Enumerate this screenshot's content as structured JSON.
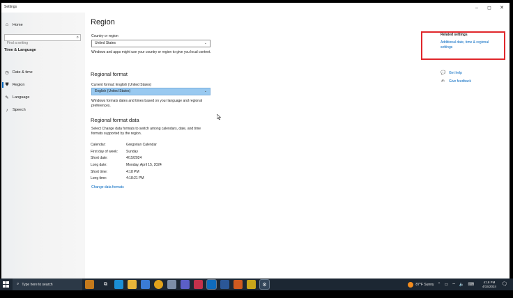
{
  "window": {
    "title": "Settings",
    "buttons": {
      "minimize": "–",
      "maximize": "◻",
      "close": "✕"
    }
  },
  "sidebar": {
    "home_label": "Home",
    "search_placeholder": "Find a setting",
    "section_title": "Time & Language",
    "items": [
      {
        "label": "Date & time",
        "icon": "calendar-clock-icon",
        "active": false
      },
      {
        "label": "Region",
        "icon": "globe-icon",
        "active": true
      },
      {
        "label": "Language",
        "icon": "language-icon",
        "active": false
      },
      {
        "label": "Speech",
        "icon": "microphone-icon",
        "active": false
      }
    ]
  },
  "main": {
    "title": "Region",
    "country_label": "Country or region",
    "country_value": "United States",
    "country_desc": "Windows and apps might use your country or region to give you local content.",
    "regional_format_heading": "Regional format",
    "current_format_label": "Current format: English (United States)",
    "format_value": "English (United States)",
    "format_desc": "Windows formats dates and times based on your language and regional preferences.",
    "format_data_heading": "Regional format data",
    "format_data_desc": "Select Change data formats to switch among calendars, date, and time formats supported by the region.",
    "data_rows": [
      {
        "key": "Calendar:",
        "value": "Gregorian Calendar"
      },
      {
        "key": "First day of week:",
        "value": "Sunday"
      },
      {
        "key": "Short date:",
        "value": "4/15/2024"
      },
      {
        "key": "Long date:",
        "value": "Monday, April 15, 2024"
      },
      {
        "key": "Short time:",
        "value": "4:18 PM"
      },
      {
        "key": "Long time:",
        "value": "4:18:21 PM"
      }
    ],
    "change_link": "Change data formats"
  },
  "related": {
    "title": "Related settings",
    "link": "Additional date, time & regional settings",
    "get_help": "Get help",
    "give_feedback": "Give feedback"
  },
  "taskbar": {
    "search_placeholder": "Type here to search",
    "weather": "87°F  Sunny",
    "time": "4:18 PM",
    "date": "4/15/2024"
  },
  "colors": {
    "accent": "#0067c0",
    "highlight_select": "#99c9f0",
    "annotation_box": "#e0272b",
    "taskbar": "#1c2733"
  }
}
